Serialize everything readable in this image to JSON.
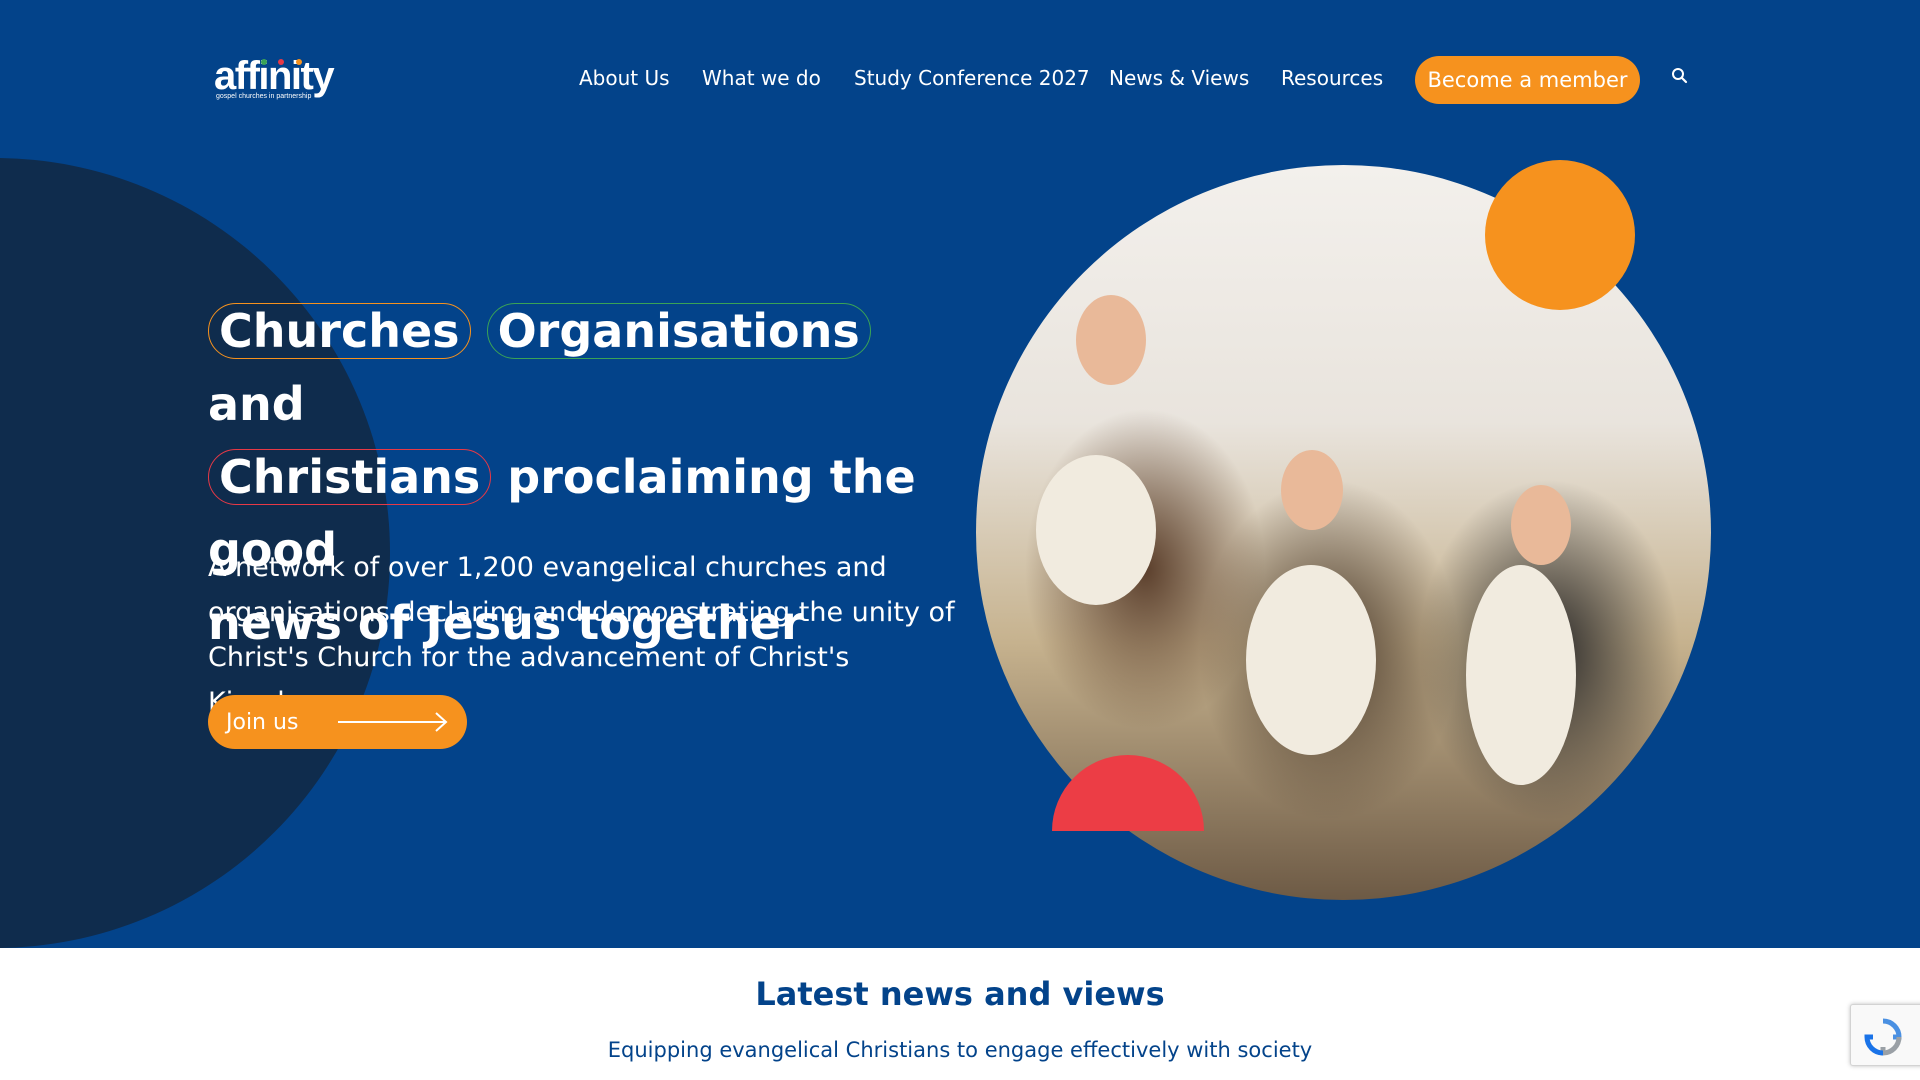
{
  "logo": {
    "text": "affinity",
    "tagline": "gospel churches in partnership"
  },
  "nav": {
    "items": [
      "About Us",
      "What we do",
      "Study Conference 2027",
      "News & Views",
      "Resources"
    ],
    "cta": "Become a member"
  },
  "hero": {
    "pill_churches": "Churches",
    "pill_organisations": "Organisations",
    "word_and": "and",
    "pill_christians": "Christians",
    "headline_rest_1": "proclaiming the good",
    "headline_rest_2": "news of Jesus together",
    "description": "A network of over 1,200 evangelical churches and organisations declaring and demonstrating the unity of Christ's Church for the advancement of Christ's Kingdom.",
    "cta": "Join us"
  },
  "news": {
    "title": "Latest news and views",
    "subtitle": "Equipping evangelical Christians to engage effectively with society"
  },
  "colors": {
    "primary_blue": "#03438a",
    "dark_navy": "#0f2c4d",
    "accent_orange": "#f6921e",
    "accent_green": "#3aa356",
    "accent_red": "#e63946"
  },
  "icons": [
    "search-icon",
    "arrow-right-icon",
    "recaptcha-icon"
  ]
}
